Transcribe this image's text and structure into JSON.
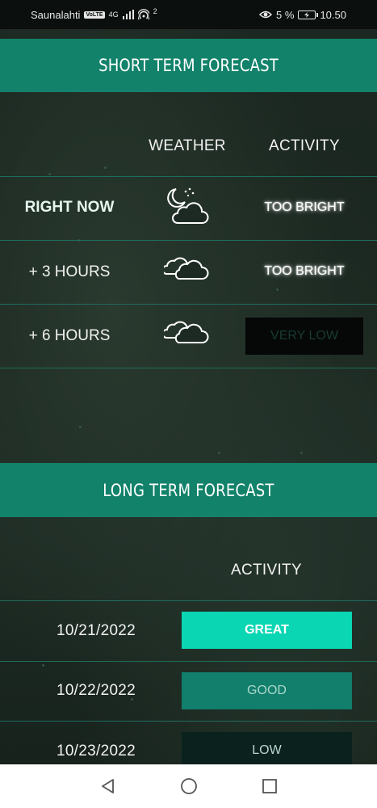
{
  "status_bar": {
    "carrier": "Saunalahti",
    "volte": "VoLTE",
    "network": "4G",
    "hotspot_count": "2",
    "battery": "5 %",
    "time": "10.50"
  },
  "short_term": {
    "title": "SHORT TERM FORECAST",
    "col_weather": "WEATHER",
    "col_activity": "ACTIVITY",
    "rows": [
      {
        "label": "RIGHT NOW",
        "weather_icon": "night-cloud-icon",
        "activity": "TOO BRIGHT"
      },
      {
        "label": "+ 3 HOURS",
        "weather_icon": "clouds-icon",
        "activity": "TOO BRIGHT"
      },
      {
        "label": "+ 6 HOURS",
        "weather_icon": "clouds-icon",
        "activity": "VERY LOW"
      }
    ]
  },
  "long_term": {
    "title": "LONG TERM FORECAST",
    "col_activity": "ACTIVITY",
    "rows": [
      {
        "date": "10/21/2022",
        "activity": "GREAT"
      },
      {
        "date": "10/22/2022",
        "activity": "GOOD"
      },
      {
        "date": "10/23/2022",
        "activity": "LOW"
      }
    ]
  },
  "nav": {
    "back_icon": "back-triangle-icon",
    "home_icon": "home-circle-icon",
    "recents_icon": "recents-square-icon"
  },
  "colors": {
    "accent": "#12826a",
    "great": "#0ad6b4",
    "good": "#127e6c",
    "low": "#0a211d"
  }
}
